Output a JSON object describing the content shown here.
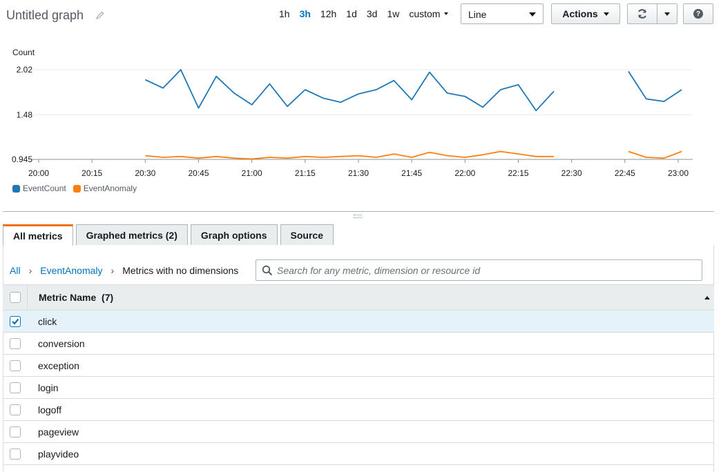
{
  "header": {
    "title": "Untitled graph",
    "time_ranges": [
      "1h",
      "3h",
      "12h",
      "1d",
      "3d",
      "1w"
    ],
    "active_range": "3h",
    "custom_label": "custom",
    "chart_type": "Line",
    "actions_label": "Actions"
  },
  "chart_data": {
    "type": "line",
    "ylabel": "Count",
    "y_ticks": [
      "2.02",
      "1.48",
      "0.945"
    ],
    "ylim": [
      0.945,
      2.02
    ],
    "x_ticks": [
      "20:00",
      "20:15",
      "20:30",
      "20:45",
      "21:00",
      "21:15",
      "21:30",
      "21:45",
      "22:00",
      "22:15",
      "22:30",
      "22:45",
      "23:00"
    ],
    "x_domain_minutes": [
      0,
      180
    ],
    "series": [
      {
        "name": "EventCount",
        "color": "#1f77b4",
        "segments": [
          [
            [
              30,
              1.9
            ],
            [
              35,
              1.8
            ],
            [
              40,
              2.02
            ],
            [
              45,
              1.56
            ],
            [
              50,
              1.94
            ],
            [
              55,
              1.74
            ],
            [
              60,
              1.6
            ],
            [
              65,
              1.85
            ],
            [
              70,
              1.58
            ],
            [
              75,
              1.78
            ],
            [
              80,
              1.68
            ],
            [
              85,
              1.63
            ],
            [
              90,
              1.73
            ],
            [
              95,
              1.78
            ],
            [
              100,
              1.89
            ],
            [
              105,
              1.66
            ],
            [
              110,
              1.99
            ],
            [
              115,
              1.74
            ],
            [
              120,
              1.7
            ],
            [
              125,
              1.57
            ],
            [
              130,
              1.78
            ],
            [
              135,
              1.84
            ],
            [
              140,
              1.53
            ],
            [
              145,
              1.76
            ]
          ],
          [
            [
              166,
              2.0
            ],
            [
              171,
              1.67
            ],
            [
              176,
              1.64
            ],
            [
              181,
              1.78
            ]
          ]
        ]
      },
      {
        "name": "EventAnomaly",
        "color": "#ff7f0e",
        "segments": [
          [
            [
              30,
              0.99
            ],
            [
              35,
              0.97
            ],
            [
              40,
              0.98
            ],
            [
              45,
              0.96
            ],
            [
              50,
              0.98
            ],
            [
              55,
              0.96
            ],
            [
              60,
              0.95
            ],
            [
              65,
              0.97
            ],
            [
              70,
              0.96
            ],
            [
              75,
              0.98
            ],
            [
              80,
              0.97
            ],
            [
              85,
              0.98
            ],
            [
              90,
              0.99
            ],
            [
              95,
              0.97
            ],
            [
              100,
              1.01
            ],
            [
              105,
              0.97
            ],
            [
              110,
              1.03
            ],
            [
              115,
              0.99
            ],
            [
              120,
              0.97
            ],
            [
              125,
              1.0
            ],
            [
              130,
              1.04
            ],
            [
              135,
              1.01
            ],
            [
              140,
              0.98
            ],
            [
              145,
              0.98
            ]
          ],
          [
            [
              166,
              1.04
            ],
            [
              171,
              0.97
            ],
            [
              176,
              0.96
            ],
            [
              181,
              1.04
            ]
          ]
        ]
      }
    ],
    "grid": "horizontal",
    "legend_position": "bottom-left"
  },
  "tabs": [
    "All metrics",
    "Graphed metrics (2)",
    "Graph options",
    "Source"
  ],
  "breadcrumb": {
    "all": "All",
    "namespace": "EventAnomaly",
    "current": "Metrics with no dimensions"
  },
  "search": {
    "placeholder": "Search for any metric, dimension or resource id"
  },
  "table": {
    "header": "Metric Name",
    "count": "(7)",
    "header_full": "Metric Name  (7)",
    "rows": [
      {
        "name": "click",
        "checked": true
      },
      {
        "name": "conversion",
        "checked": false
      },
      {
        "name": "exception",
        "checked": false
      },
      {
        "name": "login",
        "checked": false
      },
      {
        "name": "logoff",
        "checked": false
      },
      {
        "name": "pageview",
        "checked": false
      },
      {
        "name": "playvideo",
        "checked": false
      }
    ]
  },
  "colors": {
    "accent": "#0073bb",
    "tab_active": "#ec7211",
    "selected_row": "#e6f2f9"
  }
}
